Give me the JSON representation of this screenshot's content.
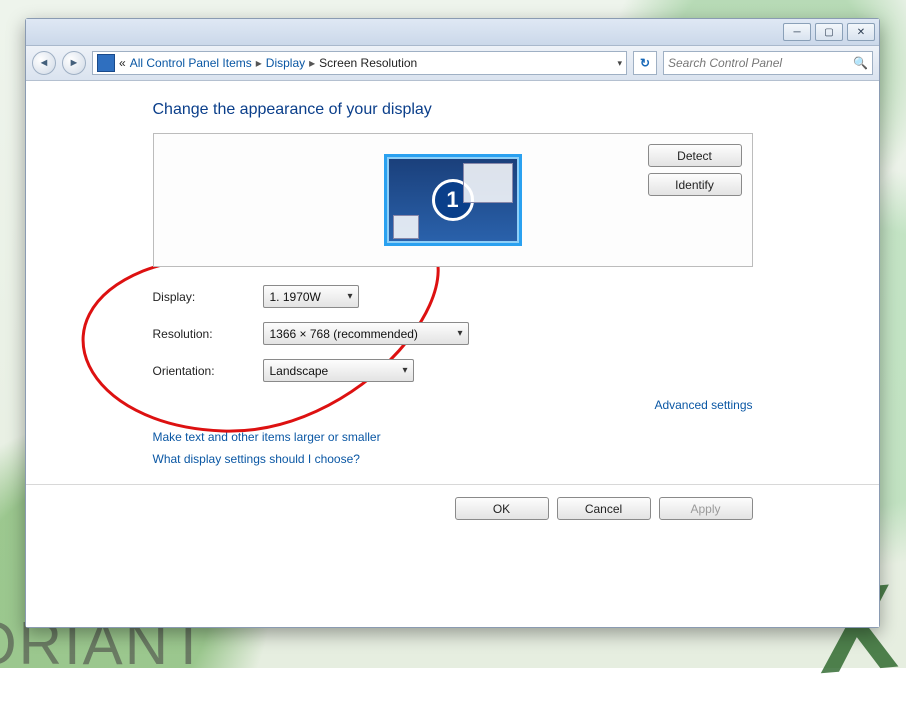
{
  "breadcrumb": {
    "prefix_glyph": "«",
    "item1": "All Control Panel Items",
    "item2": "Display",
    "item3": "Screen Resolution"
  },
  "search": {
    "placeholder": "Search Control Panel"
  },
  "page": {
    "title": "Change the appearance of your display"
  },
  "preview": {
    "monitor_number": "1"
  },
  "buttons": {
    "detect": "Detect",
    "identify": "Identify",
    "ok": "OK",
    "cancel": "Cancel",
    "apply": "Apply"
  },
  "form": {
    "display_label": "Display:",
    "resolution_label": "Resolution:",
    "orientation_label": "Orientation:",
    "display_value": "1. 1970W",
    "resolution_value": "1366 × 768 (recommended)",
    "orientation_value": "Landscape"
  },
  "links": {
    "advanced": "Advanced settings",
    "larger_smaller": "Make text and other items larger or smaller",
    "which_settings": "What display settings should I choose?"
  },
  "background": {
    "word": "ORIANT",
    "letter": "X"
  }
}
